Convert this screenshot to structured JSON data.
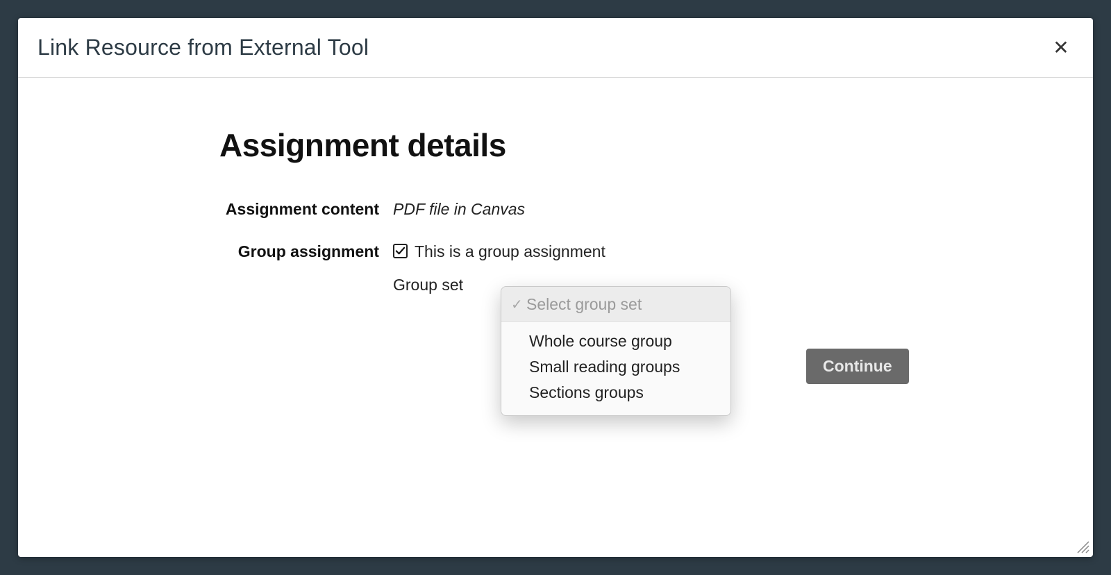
{
  "modal": {
    "title": "Link Resource from External Tool"
  },
  "page": {
    "heading": "Assignment details"
  },
  "form": {
    "content_label": "Assignment content",
    "content_value": "PDF file in Canvas",
    "group_label": "Group assignment",
    "group_checkbox_label": "This is a group assignment",
    "group_checkbox_checked": true,
    "group_set_label": "Group set"
  },
  "dropdown": {
    "placeholder": "Select group set",
    "options": [
      "Whole course group",
      "Small reading groups",
      "Sections groups"
    ]
  },
  "buttons": {
    "continue": "Continue"
  }
}
